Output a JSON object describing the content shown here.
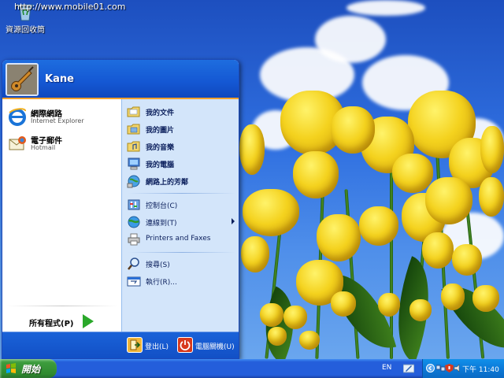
{
  "watermark": "http://www.mobile01.com",
  "desktop": {
    "icons": [
      {
        "label": "資源回收筒",
        "icon": "recycle-bin-icon"
      }
    ]
  },
  "start_menu": {
    "user_name": "Kane",
    "pinned": [
      {
        "title": "網際網路",
        "subtitle": "Internet Explorer",
        "icon": "internet-explorer-icon"
      },
      {
        "title": "電子郵件",
        "subtitle": "Hotmail",
        "icon": "email-icon"
      }
    ],
    "all_programs_label": "所有程式(P)",
    "right_items": [
      {
        "label": "我的文件",
        "icon": "folder-icon",
        "bold": true
      },
      {
        "label": "我的圖片",
        "icon": "folder-icon",
        "bold": true
      },
      {
        "label": "我的音樂",
        "icon": "folder-icon",
        "bold": true
      },
      {
        "label": "我的電腦",
        "icon": "computer-icon",
        "bold": true
      },
      {
        "label": "網路上的芳鄰",
        "icon": "network-icon",
        "bold": true
      },
      {
        "label": "控制台(C)",
        "icon": "control-panel-icon",
        "bold": false
      },
      {
        "label": "連線到(T)",
        "icon": "connect-icon",
        "bold": false
      },
      {
        "label": "Printers and Faxes",
        "icon": "printer-icon",
        "bold": false
      },
      {
        "label": "搜尋(S)",
        "icon": "search-icon",
        "bold": false
      },
      {
        "label": "執行(R)...",
        "icon": "run-icon",
        "bold": false
      }
    ],
    "footer": {
      "logoff_label": "登出(L)",
      "shutdown_label": "電腦關機(U)"
    }
  },
  "taskbar": {
    "start_label": "開始",
    "language": "EN",
    "clock": "下午 11:40"
  }
}
